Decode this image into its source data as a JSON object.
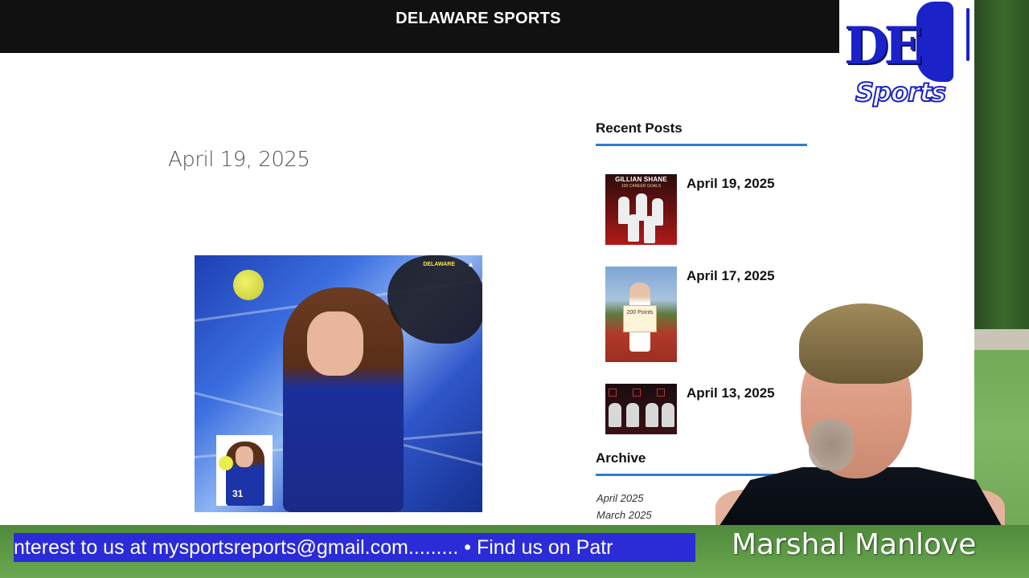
{
  "site": {
    "title": "DELAWARE SPORTS"
  },
  "post": {
    "date": "April 19, 2025",
    "image": {
      "brand_text": "DELAWARE",
      "inset_number": "31"
    }
  },
  "sidebar": {
    "recent_posts": {
      "title": "Recent Posts",
      "items": [
        {
          "date": "April 19, 2025",
          "thumb_title": "GILLIAN SHANE",
          "thumb_subtitle": "100 CAREER GOALS"
        },
        {
          "date": "April 17, 2025",
          "thumb_sign": "200 Points"
        },
        {
          "date": "April 13, 2025"
        }
      ]
    },
    "archive": {
      "title": "Archive",
      "links": [
        "April 2025",
        "March 2025"
      ]
    }
  },
  "overlay": {
    "logo": {
      "letters": "DE",
      "word": "Sports"
    },
    "ticker": "nterest to us at mysportsreports@gmail.com......... • Find us on Patr",
    "host_name": "Marshal Manlove"
  },
  "colors": {
    "accent_rule": "#2b7bd8",
    "header_bg": "#111111",
    "ticker_bg": "#2b2bd8",
    "logo_blue": "#1a22c8"
  }
}
